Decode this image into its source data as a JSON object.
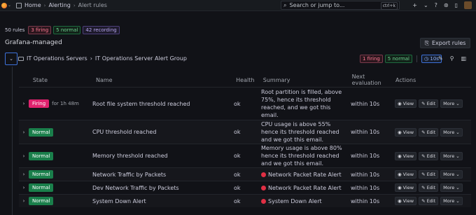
{
  "breadcrumbs": [
    "Home",
    "Alerting",
    "Alert rules"
  ],
  "search": {
    "placeholder": "Search or jump to...",
    "shortcut": "ctrl+k"
  },
  "top_icons": {
    "add": "+",
    "help": "?",
    "news": "⊛",
    "notifications": "▯"
  },
  "summary": {
    "count": "50 rules",
    "firing": "3 firing",
    "normal": "5 normal",
    "recording": "42 recording"
  },
  "section_title": "Grafana-managed",
  "export_label": "Export rules",
  "group": {
    "folder": "IT Operations Servers",
    "name": "IT Operations Server Alert Group",
    "firing": "1 firing",
    "normal": "5 normal",
    "interval": "10s"
  },
  "columns": [
    "State",
    "Name",
    "Health",
    "Summary",
    "Next evaluation",
    "Actions"
  ],
  "actions": {
    "view": "View",
    "edit": "Edit",
    "more": "More"
  },
  "rows": [
    {
      "state": "Firing",
      "since": "for 1h 48m",
      "name": "Root file system threshold reached",
      "health": "ok",
      "summary": "Root partition is filled, above 75%, hence its threshold reached, and we got this email.",
      "next": "within 10s"
    },
    {
      "state": "Normal",
      "since": "",
      "name": "CPU threshold reached",
      "health": "ok",
      "summary": "CPU usage is above 55% hence its threshold reached and we got this email.",
      "next": "within 10s"
    },
    {
      "state": "Normal",
      "since": "",
      "name": "Memory threshold reached",
      "health": "ok",
      "summary": "Memory usage is above 80% hence its threshold reached and we got this email.",
      "next": "within 10s"
    },
    {
      "state": "Normal",
      "since": "",
      "name": "Network Traffic by Packets",
      "health": "ok",
      "summary": "Network Packet Rate Alert",
      "next": "within 10s"
    },
    {
      "state": "Normal",
      "since": "",
      "name": "Dev Network Traffic by Packets",
      "health": "ok",
      "summary": "Network Packet Rate Alert",
      "next": "within 10s"
    },
    {
      "state": "Normal",
      "since": "",
      "name": "System Down Alert",
      "health": "ok",
      "summary": "System Down Alert",
      "next": "within 10s"
    }
  ]
}
